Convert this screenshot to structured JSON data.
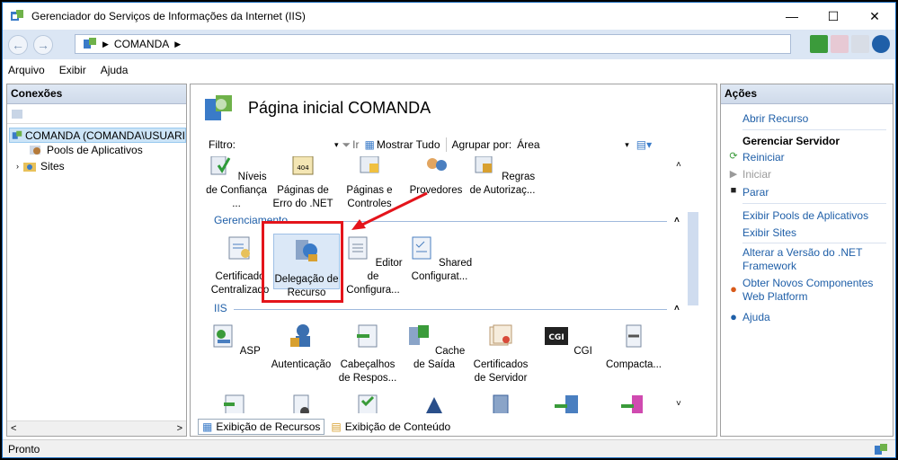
{
  "window": {
    "title": "Gerenciador do Serviços de Informações da Internet (IIS)",
    "controls": {
      "minimize": "—",
      "maximize": "☐",
      "close": "✕"
    }
  },
  "address": {
    "back": "←",
    "forward": "→",
    "segment": "COMANDA",
    "arrow1": "▶",
    "arrow2": "▶"
  },
  "menu": [
    "Arquivo",
    "Exibir",
    "Ajuda"
  ],
  "connections": {
    "title": "Conexões",
    "tree": [
      {
        "label": "COMANDA (COMANDA\\USUARI",
        "selected": true
      },
      {
        "label": "Pools de Aplicativos"
      },
      {
        "label": "Sites"
      }
    ],
    "scroll_left": "<",
    "scroll_right": ">"
  },
  "center": {
    "title": "Página inicial COMANDA",
    "filter_label": "Filtro:",
    "go_label": "Ir",
    "show_all_label": "Mostrar Tudo",
    "group_by_label": "Agrupar por:",
    "group_by_value": "Área",
    "top_row": [
      "Níveis de Confiança ...",
      "Páginas de Erro do .NET",
      "Páginas e Controles",
      "Provedores",
      "Regras de Autorizaç..."
    ],
    "group_mgmt": "Gerenciamento",
    "mgmt_items": [
      "Certificado Centralizado",
      "Delegação de Recurso",
      "Editor de Configura...",
      "Shared Configurat..."
    ],
    "group_iis": "IIS",
    "iis_items": [
      "ASP",
      "Autenticação",
      "Cabeçalhos de Respos...",
      "Cache de Saída",
      "Certificados de Servidor",
      "CGI",
      "Compacta..."
    ],
    "cgi_icon_text": "CGI",
    "tab_features": "Exibição de Recursos",
    "tab_content": "Exibição de Conteúdo"
  },
  "actions": {
    "title": "Ações",
    "open_feature": "Abrir Recurso",
    "manage_server": "Gerenciar Servidor",
    "restart": "Reiniciar",
    "start": "Iniciar",
    "stop": "Parar",
    "view_pools": "Exibir Pools de Aplicativos",
    "view_sites": "Exibir Sites",
    "change_net": "Alterar a Versão do .NET Framework",
    "get_components": "Obter Novos Componentes Web Platform",
    "help": "Ajuda"
  },
  "status": {
    "text": "Pronto"
  },
  "colors": {
    "link": "#1f5fa8",
    "annotation": "#e4141b",
    "selection": "#cce4f7"
  }
}
